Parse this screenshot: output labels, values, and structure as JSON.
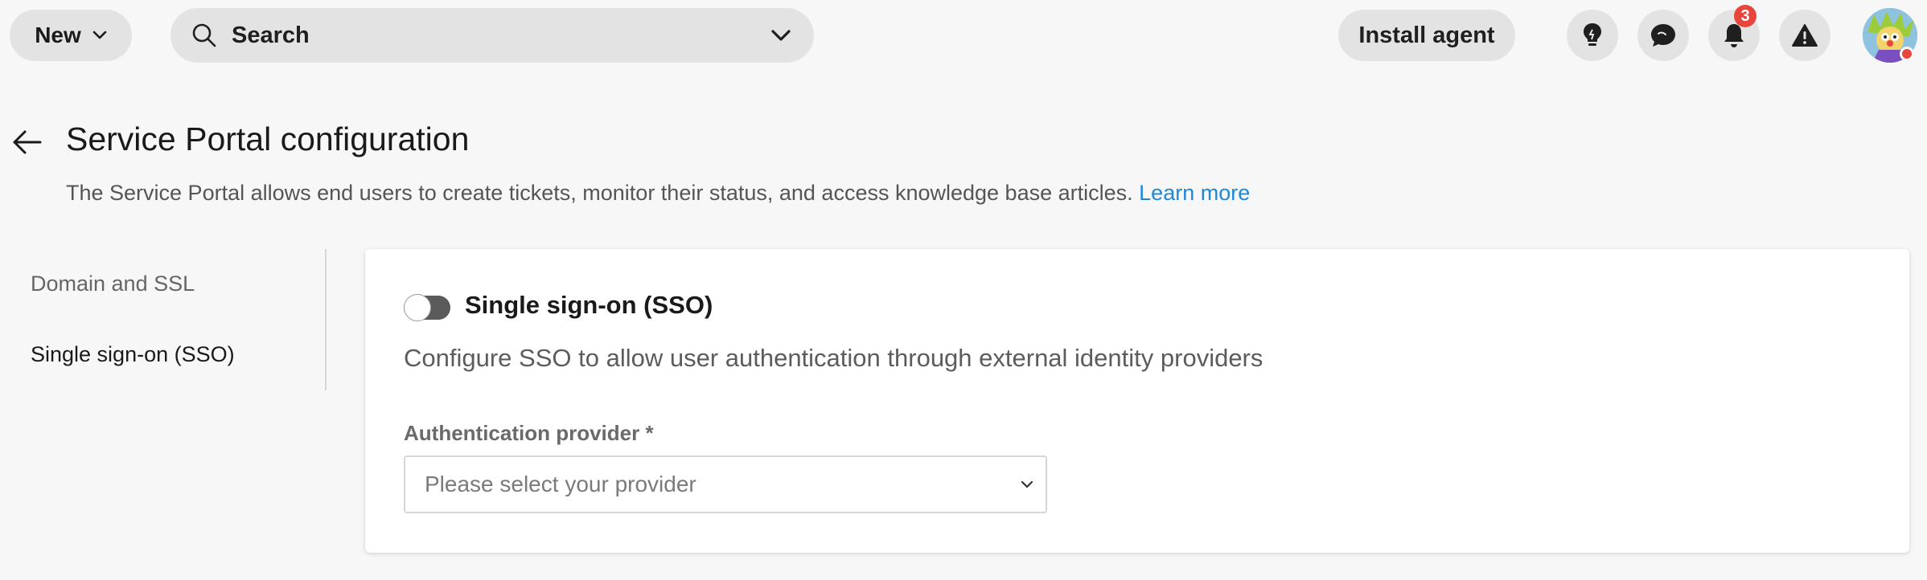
{
  "topbar": {
    "new_label": "New",
    "search_label": "Search",
    "install_label": "Install agent",
    "notifications_count": "3"
  },
  "header": {
    "title": "Service Portal configuration",
    "description": "The Service Portal allows end users to create tickets, monitor their status, and access knowledge base articles.",
    "learn_more": "Learn more"
  },
  "sidebar": {
    "items": [
      {
        "label": "Domain and SSL"
      },
      {
        "label": "Single sign-on (SSO)"
      }
    ]
  },
  "sso": {
    "title": "Single sign-on (SSO)",
    "description": "Configure SSO to allow user authentication through external identity providers",
    "enabled": false,
    "provider_label": "Authentication provider *",
    "provider_placeholder": "Please select your provider"
  },
  "colors": {
    "accent_link": "#1e88d6",
    "badge": "#e8453c",
    "pill_bg": "#e3e3e3"
  },
  "icons": {
    "new_chevron": "chevron-down-icon",
    "search": "search-icon",
    "search_chevron": "chevron-down-icon",
    "tips": "lightbulb-icon",
    "chat": "chat-icon",
    "notifications": "bell-icon",
    "alerts": "warning-icon",
    "back": "arrow-left-icon",
    "select_chevron": "chevron-down-icon"
  }
}
